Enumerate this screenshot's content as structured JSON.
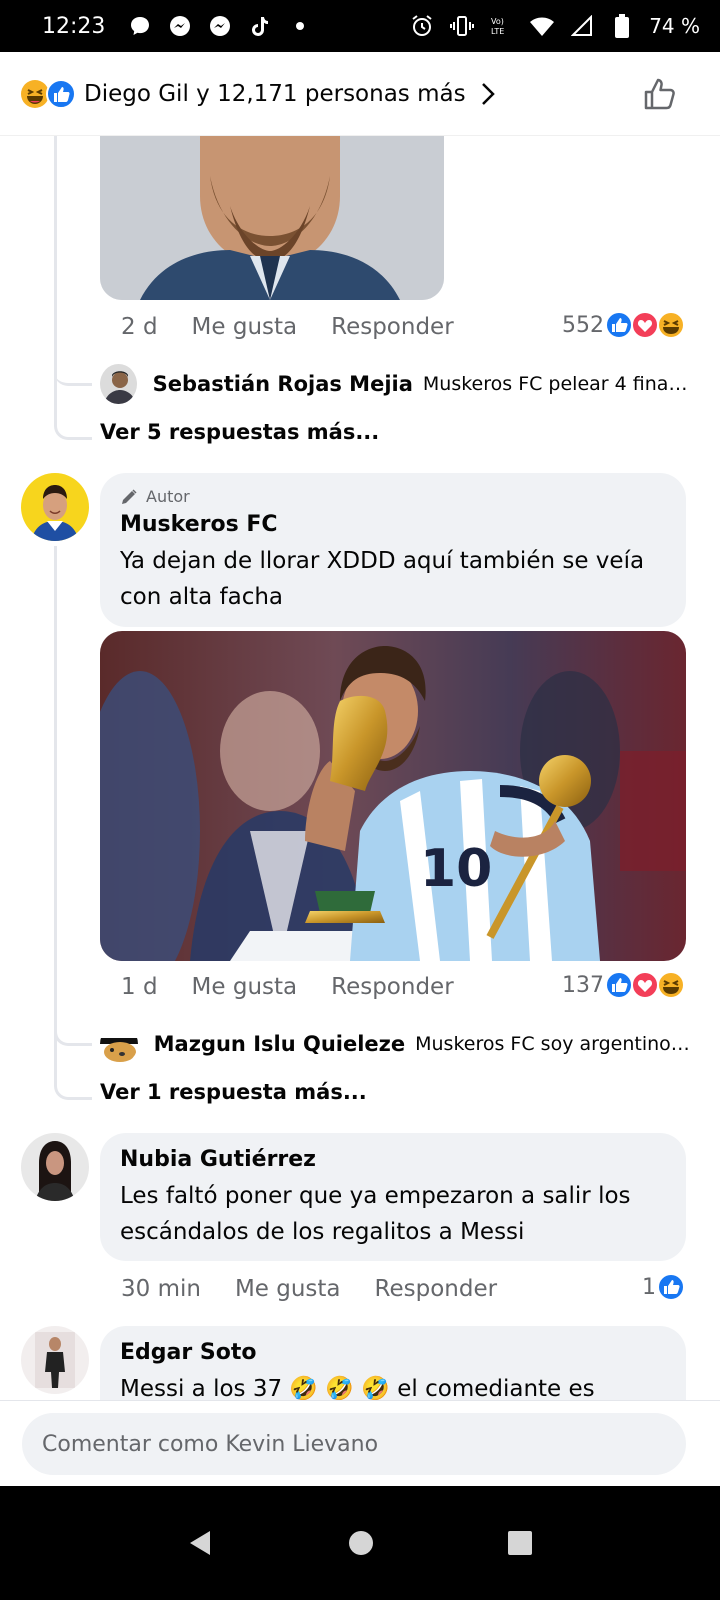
{
  "status_bar": {
    "time": "12:23",
    "battery": "74 %",
    "notification_icons": [
      "chat-bubble-icon",
      "messenger-icon",
      "messenger-icon",
      "tiktok-icon",
      "dot-icon"
    ],
    "system_icons": [
      "alarm-icon",
      "vibrate-icon",
      "volte-icon",
      "wifi-icon",
      "signal-icon",
      "battery-icon"
    ]
  },
  "reactions_header": {
    "summary": "Diego Gil y 12,171 personas más",
    "reaction_icons": [
      "haha-icon",
      "like-icon"
    ]
  },
  "thread1": {
    "time": "2 d",
    "like_label": "Me gusta",
    "reply_label": "Responder",
    "reaction_count": "552",
    "reply": {
      "name": "Sebastián Rojas Mejia",
      "text": "Muskeros FC pelear 4 finales…"
    },
    "more_replies": "Ver 5 respuestas más..."
  },
  "comment_muskeros": {
    "author_tag": "Autor",
    "name": "Muskeros FC",
    "text": "Ya dejan de llorar XDDD aquí también se veía con alta facha",
    "time": "1 d",
    "like_label": "Me gusta",
    "reply_label": "Responder",
    "reaction_count": "137",
    "reply": {
      "name": "Mazgun Islu Quieleze",
      "text": "Muskeros FC soy argentino y…"
    },
    "more_replies": "Ver 1 respuesta más..."
  },
  "comment_nubia": {
    "name": "Nubia Gutiérrez",
    "text": "Les faltó poner que ya empezaron a salir los escándalos de los regalitos a Messi",
    "time": "30 min",
    "like_label": "Me gusta",
    "reply_label": "Responder",
    "reaction_count": "1"
  },
  "comment_edgar": {
    "name": "Edgar Soto",
    "text": "Messi a los 37 🤣 🤣 🤣 el comediante es"
  },
  "composer": {
    "placeholder": "Comentar como Kevin Lievano"
  },
  "colors": {
    "like_blue": "#1877f2",
    "love_red": "#f33e58",
    "haha_yellow": "#f7b125",
    "bubble_gray": "#f0f2f5",
    "meta_gray": "#65676b"
  }
}
